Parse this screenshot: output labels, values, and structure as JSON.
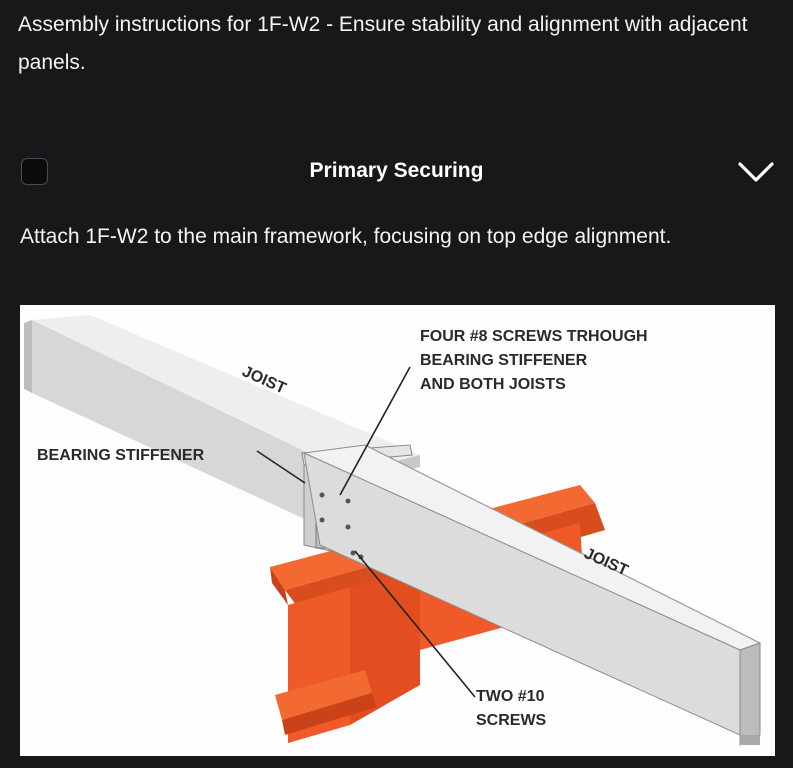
{
  "intro": {
    "text": "Assembly instructions for 1F-W2 - Ensure stability and alignment with adjacent panels."
  },
  "section": {
    "title": "Primary Securing",
    "checked": false,
    "expanded": true,
    "description": "Attach 1F-W2 to the main framework, focusing on top edge alignment."
  },
  "diagram": {
    "labels": {
      "joist_top": "JOIST",
      "bearing_stiffener": "BEARING STIFFENER",
      "four_screws_line1": "FOUR #8 SCREWS TRHOUGH",
      "four_screws_line2": "BEARING STIFFENER",
      "four_screws_line3": "AND BOTH JOISTS",
      "joist_right": "JOIST",
      "two_screws_line1": "TWO #10",
      "two_screws_line2": "SCREWS"
    },
    "colors": {
      "steel_beam": "#f05a28",
      "joist": "#d8d8d8"
    }
  }
}
